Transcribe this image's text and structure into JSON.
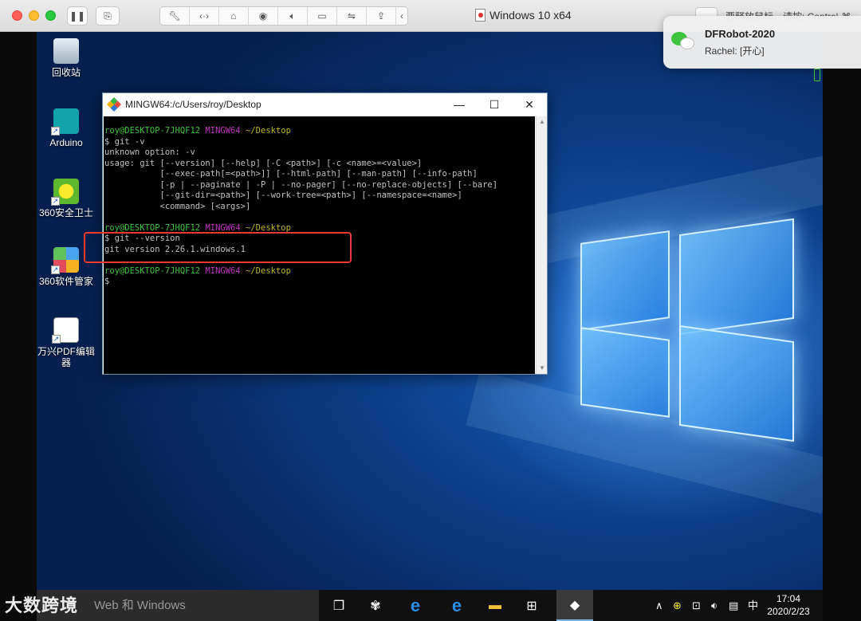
{
  "mac_window": {
    "vm_title": "Windows 10 x64",
    "hint_text": "要释放鼠标，请按: Control-⌘",
    "toolbar_icons": [
      "pause-icon",
      "snapshot-icon",
      "wrench-icon",
      "code-icon",
      "disk-icon",
      "camera-icon",
      "speaker-icon",
      "video-icon",
      "usb-icon",
      "share-icon",
      "chevron-left-icon"
    ]
  },
  "notification": {
    "title": "DFRobot-2020",
    "body": "Rachel: [开心]",
    "app_icon": "wechat-icon",
    "accent": "#3ec43c"
  },
  "desktop": {
    "icons": [
      {
        "label": "回收站",
        "icon": "recycle-bin-icon"
      },
      {
        "label": "Arduino",
        "icon": "arduino-icon"
      },
      {
        "label": "360安全卫士",
        "icon": "360-safe-icon"
      },
      {
        "label": "360软件管家",
        "icon": "360-software-icon"
      },
      {
        "label": "万兴PDF编辑器",
        "icon": "pdf-editor-icon"
      }
    ]
  },
  "terminal": {
    "title": "MINGW64:/c/Users/roy/Desktop",
    "prompt_user": "roy@DESKTOP-7JHQF12",
    "prompt_env": "MINGW64",
    "prompt_path": "~/Desktop",
    "lines": {
      "cmd1": "$ git -v",
      "out1": "unknown option: -v",
      "out2": "usage: git [--version] [--help] [-C <path>] [-c <name>=<value>]",
      "out3": "           [--exec-path[=<path>]] [--html-path] [--man-path] [--info-path]",
      "out4": "           [-p | --paginate | -P | --no-pager] [--no-replace-objects] [--bare]",
      "out5": "           [--git-dir=<path>] [--work-tree=<path>] [--namespace=<name>]",
      "out6": "           <command> [<args>]",
      "cmd2": "$ git --version",
      "out7": "git version 2.26.1.windows.1",
      "cmd3": "$"
    },
    "highlight_color": "#e8392c"
  },
  "taskbar": {
    "search_placeholder": "Web 和 Windows",
    "watermark": "大数跨境",
    "ime": "中",
    "time": "17:04",
    "date": "2020/2/23"
  }
}
